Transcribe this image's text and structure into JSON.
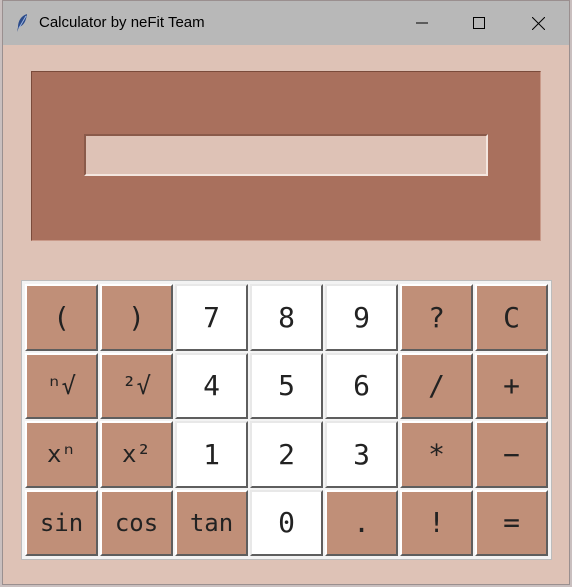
{
  "window": {
    "title": "Calculator by neFit Team",
    "icon": "feather-icon",
    "controls": [
      "minimize-icon",
      "maximize-icon",
      "close-icon"
    ]
  },
  "display": {
    "value": ""
  },
  "keypad": {
    "rows": [
      [
        {
          "label": "(",
          "type": "op"
        },
        {
          "label": ")",
          "type": "op"
        },
        {
          "label": "7",
          "type": "num"
        },
        {
          "label": "8",
          "type": "num"
        },
        {
          "label": "9",
          "type": "num"
        },
        {
          "label": "?",
          "type": "op"
        },
        {
          "label": "C",
          "type": "op"
        }
      ],
      [
        {
          "label": "ⁿ√",
          "type": "op"
        },
        {
          "label": "²√",
          "type": "op"
        },
        {
          "label": "4",
          "type": "num"
        },
        {
          "label": "5",
          "type": "num"
        },
        {
          "label": "6",
          "type": "num"
        },
        {
          "label": "/",
          "type": "op"
        },
        {
          "label": "+",
          "type": "op"
        }
      ],
      [
        {
          "label": "xⁿ",
          "type": "op"
        },
        {
          "label": "x²",
          "type": "op"
        },
        {
          "label": "1",
          "type": "num"
        },
        {
          "label": "2",
          "type": "num"
        },
        {
          "label": "3",
          "type": "num"
        },
        {
          "label": "*",
          "type": "op"
        },
        {
          "label": "−",
          "type": "op"
        }
      ],
      [
        {
          "label": "sin",
          "type": "op"
        },
        {
          "label": "cos",
          "type": "op"
        },
        {
          "label": "tan",
          "type": "op"
        },
        {
          "label": "0",
          "type": "num"
        },
        {
          "label": ".",
          "type": "op"
        },
        {
          "label": "!",
          "type": "op"
        },
        {
          "label": "=",
          "type": "op"
        }
      ]
    ]
  },
  "colors": {
    "window_bg": "#dec2b6",
    "display_panel": "#a9705d",
    "operator_key": "#c08f78",
    "number_key": "#ffffff",
    "titlebar": "#b8b8b8"
  }
}
